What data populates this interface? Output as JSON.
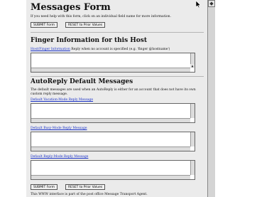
{
  "header": {
    "title": "Messages Form",
    "help_text": "If you need help with this form, click on an individual field name for more information."
  },
  "buttons": {
    "submit_label": "SUBMIT Form",
    "reset_label": "RESET to Prior Values"
  },
  "finger": {
    "heading": "Finger Information for this Host",
    "field_link": "Host/Finger Information",
    "field_note": "Reply when no account is specified (e.g. 'finger @hostname')"
  },
  "autoreply": {
    "heading": "AutoReply Default Messages",
    "description": "The default messages are used when an AutoReply is either for an account that does not have its own custom reply message.",
    "fields": [
      {
        "label": "Default Vacation-Mode Reply Message"
      },
      {
        "label": "Default Busy-Mode Reply Message"
      },
      {
        "label": "Default Reply-Mode Reply Message"
      }
    ]
  },
  "footer": {
    "text": "This WWW interface is part of the post office Message Transport Agent."
  },
  "icons": {
    "cursor": "arrow-cursor-icon",
    "scroll_up": "scroll-up-arrow-icon"
  }
}
